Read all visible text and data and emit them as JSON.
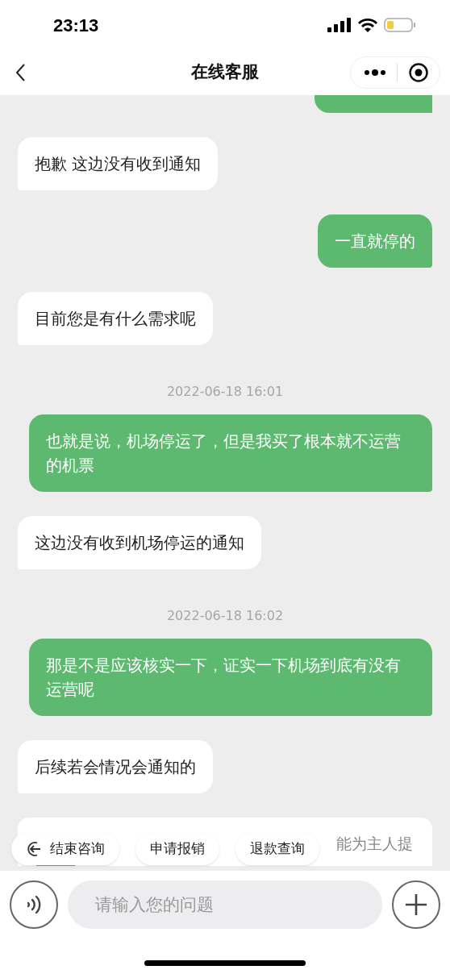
{
  "status_bar": {
    "time": "23:13"
  },
  "nav": {
    "title": "在线客服"
  },
  "messages": [
    {
      "kind": "partial",
      "outgoing": true
    },
    {
      "kind": "bubble",
      "outgoing": false,
      "text": "抱歉 这边没有收到通知"
    },
    {
      "kind": "bubble",
      "outgoing": true,
      "text": "一直就停的"
    },
    {
      "kind": "bubble",
      "outgoing": false,
      "text": "目前您是有什么需求呢"
    },
    {
      "kind": "time",
      "text": "2022-06-18 16:01"
    },
    {
      "kind": "bubble",
      "outgoing": true,
      "text": "也就是说，机场停运了，但是我买了根本就不运营的机票"
    },
    {
      "kind": "bubble",
      "outgoing": false,
      "text": "这边没有收到机场停运的通知"
    },
    {
      "kind": "time",
      "text": "2022-06-18 16:02"
    },
    {
      "kind": "bubble",
      "outgoing": true,
      "text": "那是不是应该核实一下，证实一下机场到底有没有运营呢"
    },
    {
      "kind": "bubble",
      "outgoing": false,
      "text": "后续若会情况会通知的"
    },
    {
      "kind": "card",
      "text": "能为主人提"
    }
  ],
  "quick_replies": [
    {
      "kind": "exit",
      "label": "结束咨询"
    },
    {
      "kind": "plain",
      "label": "申请报销"
    },
    {
      "kind": "plain",
      "label": "退款查询"
    }
  ],
  "input": {
    "placeholder": "请输入您的问题"
  }
}
